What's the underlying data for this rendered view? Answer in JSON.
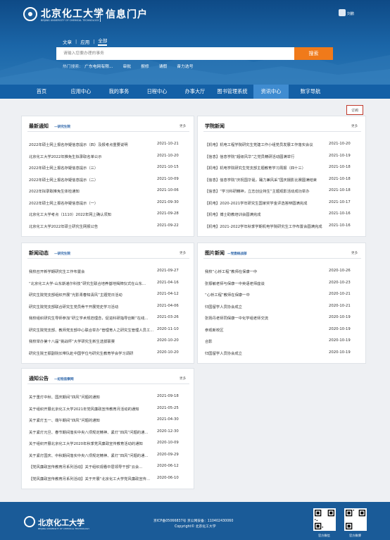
{
  "header": {
    "logo_cn": "北京化工大学",
    "logo_en": "BEIJING UNIVERSITY OF CHEMICAL TECHNOLOGY",
    "portal_title": "信息门户",
    "user_name": "刘鹏"
  },
  "search": {
    "tabs": [
      "文章",
      "应用",
      "全部"
    ],
    "active_tab": "全部",
    "placeholder": "请输入您要办理的事务",
    "button": "搜索",
    "hot_label": "热门搜索:",
    "hot_items": [
      "广东电网有限...",
      "审批",
      "报修",
      "请假",
      "奋力选号"
    ]
  },
  "nav": {
    "items": [
      "首页",
      "应用中心",
      "我的事务",
      "日程中心",
      "办事大厅",
      "图书管理系统",
      "资讯中心",
      "数字导航"
    ],
    "active": "资讯中心"
  },
  "subscribe_label": "订阅",
  "more_label": "更多",
  "panels": {
    "latest": {
      "title": "最新通知",
      "sub": "—研究生院",
      "rows": [
        [
          "2022年硕士网上报名存疑信息提示（四）及报考点重要说明",
          "2021-10-21"
        ],
        [
          "北京化工大学2022年推免生拟录取名单公示",
          "2021-10-20"
        ],
        [
          "2022年硕士网上报名存疑信息提示（三）",
          "2021-10-15"
        ],
        [
          "2022年硕士网上报名存疑信息提示（二）",
          "2021-10-09"
        ],
        [
          "2022年拟录取推免生体检通知",
          "2021-10-06"
        ],
        [
          "2022年硕士网上报名存疑信息提示（一）",
          "2021-09-30"
        ],
        [
          "北京化工大学考点（1110）2022年网上确认须知",
          "2021-09-28"
        ],
        [
          "北京化工大学2022年硕士研究生网报公告",
          "2021-09-22"
        ]
      ]
    },
    "college": {
      "title": "学院新闻",
      "sub": "",
      "rows": [
        [
          "【机电】机电工程学院研究生党建工作小组党员发展工作落实会议",
          "2021-10-20"
        ],
        [
          "【信息】信息学院“超级风华”之党员精研活动圆满举行",
          "2021-10-19"
        ],
        [
          "【机电】机电学院研究生党支部主题教育学习周报（四十三）",
          "2021-10-18"
        ],
        [
          "【信息】信息学院“庆祝国华诞，踊力兼风采”国庆摄影比赛圆满结束",
          "2021-10-18"
        ],
        [
          "【信息】“学习科研精神，立志创业持生”主题观影活动成功举办",
          "2021-10-18"
        ],
        [
          "【机电】2020-2021学年研究生国家奖学金评选答辩圆满完成",
          "2021-10-17"
        ],
        [
          "【机电】博士助教培训会圆满完成",
          "2021-10-16"
        ],
        [
          "【机电】2021-2022学年秋季学期机电学院研究生工作布置会圆满完成",
          "2021-10-16"
        ]
      ]
    },
    "dynamics": {
      "title": "新闻动态",
      "sub": "—研究生院",
      "rows": [
        [
          "我校召开新学期研究生工作布置会",
          "2021-09-27"
        ],
        [
          "“北京化工大学-山东斯递尔科技”研究生联合培养基地揭牌仪式在山东...",
          "2021-04-16"
        ],
        [
          "研究生院党支部组织开展“光影青春知清风”主题党日活动",
          "2021-04-12"
        ],
        [
          "研究生院党支部联合研究生党员骨干开展党史学习活动",
          "2021-04-06"
        ],
        [
          "我校组织研究生导师参加“研立学术规范理念，促进科研指导创新”在线...",
          "2021-03-26"
        ],
        [
          "研究生院党支部、教师党支部中心联合举办“管理育人之研究生管理人员工...",
          "2020-11-10"
        ],
        [
          "我校举办第十八届“挑战杯”大学研究生新生选拔联赛",
          "2020-10-20"
        ],
        [
          "研究生院王振副院长带队赴中国学位与研究生教育学会学习调研",
          "2020-10-20"
        ]
      ]
    },
    "photo": {
      "title": "图片新闻",
      "sub": "—党委统战部",
      "rows": [
        [
          "我校“心桥工程”教师在保康一中",
          "2020-10-26"
        ],
        [
          "张振敏老师与保康一中英语老师座谈",
          "2020-10-23"
        ],
        [
          "“心桥工程”教师在保康一中",
          "2020-10-21"
        ],
        [
          "归国留学人员协会成立",
          "2020-10-21"
        ],
        [
          "张扬丹老师同保康一中化学组老师交流",
          "2020-10-19"
        ],
        [
          "参观新校区",
          "2020-10-19"
        ],
        [
          "合影",
          "2020-10-19"
        ],
        [
          "归国留学人员协会成立",
          "2020-10-19"
        ]
      ]
    },
    "notice": {
      "title": "通知公告",
      "sub": "—纪检监察网",
      "rows": [
        [
          "关于重灯中秋、国庆期间“四风”问题的通知",
          "2021-09-18"
        ],
        [
          "关于组织开展北京化工大学2021年党风廉政宣传教育月活动的通知",
          "2021-05-25"
        ],
        [
          "关于紧灯五一、端午期间“四风”问题的通知",
          "2021-04-30"
        ],
        [
          "关于紧灯元旦、春节期间落实中央八项规定精神、紧灯“四风”问题的通...",
          "2020-12-30"
        ],
        [
          "关于组织开展北京化工大学2020年秋季党风廉政宣传教育活动的通知",
          "2020-10-09"
        ],
        [
          "关于紧灯国庆、中秋期间落实中央八项规定精神、紧灯“四风”问题的通...",
          "2020-09-29"
        ],
        [
          "【党风廉政宣传教育月系列活动】关于组织观看中层领导干部“云会...",
          "2020-06-12"
        ],
        [
          "【党风廉政宣传教育月系列活动】关于开展“北京化工大学党风廉政宣传...",
          "2020-06-10"
        ]
      ]
    }
  },
  "footer": {
    "logo_cn": "北京化工大学",
    "logo_en": "BEIJING UNIVERSITY OF CHEMICAL TECHNOLOGY",
    "icp": "京ICP备05066837号 京公网安备：110402430060",
    "copyright": "Copyright© 北京化工大学",
    "qr_wechat": "官方微信",
    "qr_weibo": "官方微博"
  }
}
